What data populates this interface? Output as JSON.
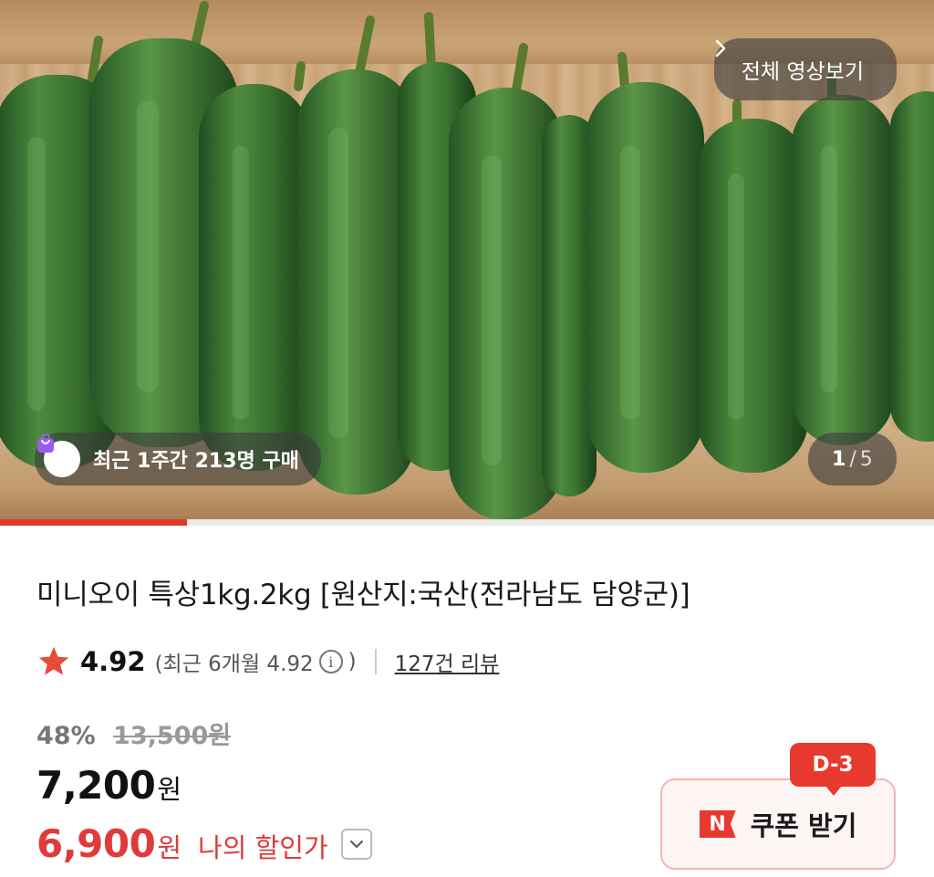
{
  "gallery": {
    "image_subject": "cucumbers",
    "video_button_label": "전체 영상보기",
    "buyers_badge": "최근 1주간 213명 구매",
    "counter_current": "1",
    "counter_separator": "/",
    "counter_total": "5",
    "progress_fraction": 0.2
  },
  "product": {
    "title": "미니오이 특상1kg.2kg [원산지:국산(전라남도 담양군)]"
  },
  "rating": {
    "score": "4.92",
    "recent_prefix": "(최근 6개월 4.92",
    "recent_suffix": ")",
    "info_icon_glyph": "i",
    "review_link": "127건 리뷰"
  },
  "pricing": {
    "discount_pct": "48%",
    "original_price": "13,500원",
    "price": "7,200",
    "price_unit": "원",
    "my_price": "6,900",
    "my_price_unit": "원",
    "my_price_label": "나의 할인가"
  },
  "coupon": {
    "dday_badge": "D-3",
    "logo_letter": "N",
    "label": "쿠폰 받기"
  },
  "colors": {
    "accent_red": "#e8392e",
    "star": "#e84a3a",
    "buyer_icon": "#9a5cf0"
  },
  "icons": {
    "star": "star-icon",
    "info": "info-icon",
    "chevron_right": "chevron-right-icon",
    "chevron_down": "chevron-down-icon",
    "bag": "shopping-bag-icon"
  }
}
